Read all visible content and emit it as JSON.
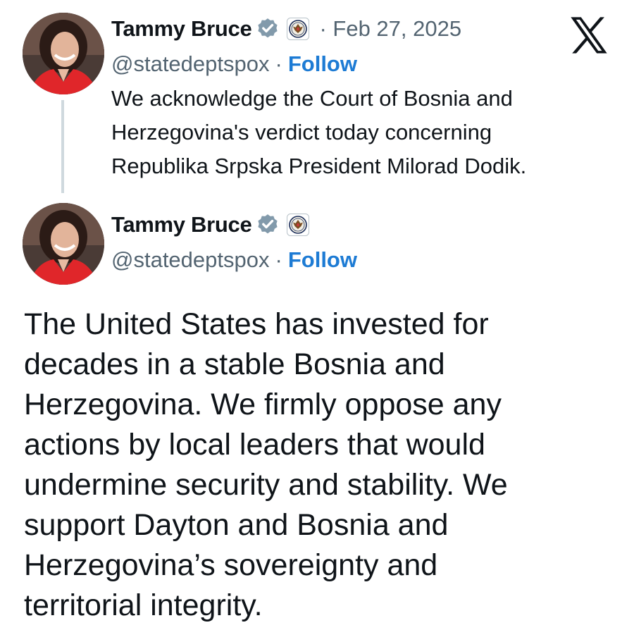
{
  "thread": {
    "parent_tweet": {
      "author": {
        "display_name": "Tammy Bruce",
        "handle": "@statedeptspox",
        "verified": true,
        "affiliate_badge_icon": "state-department-seal-icon"
      },
      "separator": "·",
      "date": "Feb 27, 2025",
      "follow_label": "Follow",
      "text_lines": [
        "We acknowledge the Court of Bosnia and",
        "Herzegovina's verdict today concerning",
        "Republika Srpska President Milorad Dodik."
      ]
    },
    "main_tweet": {
      "author": {
        "display_name": "Tammy Bruce",
        "handle": "@statedeptspox",
        "verified": true,
        "affiliate_badge_icon": "state-department-seal-icon"
      },
      "separator": "·",
      "follow_label": "Follow",
      "text_lines": [
        "The United States has invested for",
        "decades in a stable Bosnia and",
        "Herzegovina. We firmly oppose any",
        "actions by local leaders that would",
        "undermine security and stability. We",
        "support Dayton and Bosnia and",
        "Herzegovina’s sovereignty and",
        "territorial integrity."
      ]
    }
  },
  "icons": {
    "brand": "x-logo-icon",
    "verified": "verified-checkmark-icon"
  },
  "colors": {
    "text_primary": "#0f1419",
    "text_secondary": "#536471",
    "follow_link": "#1d7bd4",
    "verified_badge": "#829aab",
    "thread_line": "#cfd9de"
  }
}
